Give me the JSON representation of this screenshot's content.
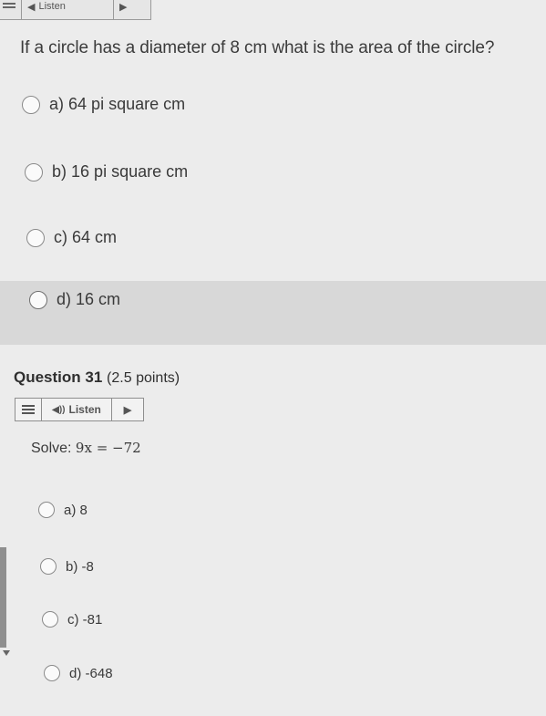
{
  "top_toolbar": {
    "label": "Listen"
  },
  "question_prev": {
    "text": "If a circle has a diameter of 8 cm what is the area of the circle?",
    "options": [
      {
        "letter": "a)",
        "text": "64 pi square cm"
      },
      {
        "letter": "b)",
        "text": "16 pi square cm"
      },
      {
        "letter": "c)",
        "text": "64 cm"
      },
      {
        "letter": "d)",
        "text": "16 cm"
      }
    ]
  },
  "question31": {
    "title": "Question 31",
    "points": "(2.5 points)",
    "listen_label": "Listen",
    "prompt_prefix": "Solve:",
    "prompt_math": "9x = −72",
    "options": [
      {
        "letter": "a)",
        "text": "8"
      },
      {
        "letter": "b)",
        "text": "-8"
      },
      {
        "letter": "c)",
        "text": "-81"
      },
      {
        "letter": "d)",
        "text": "-648"
      }
    ]
  },
  "icons": [
    "menu-icon",
    "speaker-icon",
    "play-icon",
    "radio-icon"
  ]
}
